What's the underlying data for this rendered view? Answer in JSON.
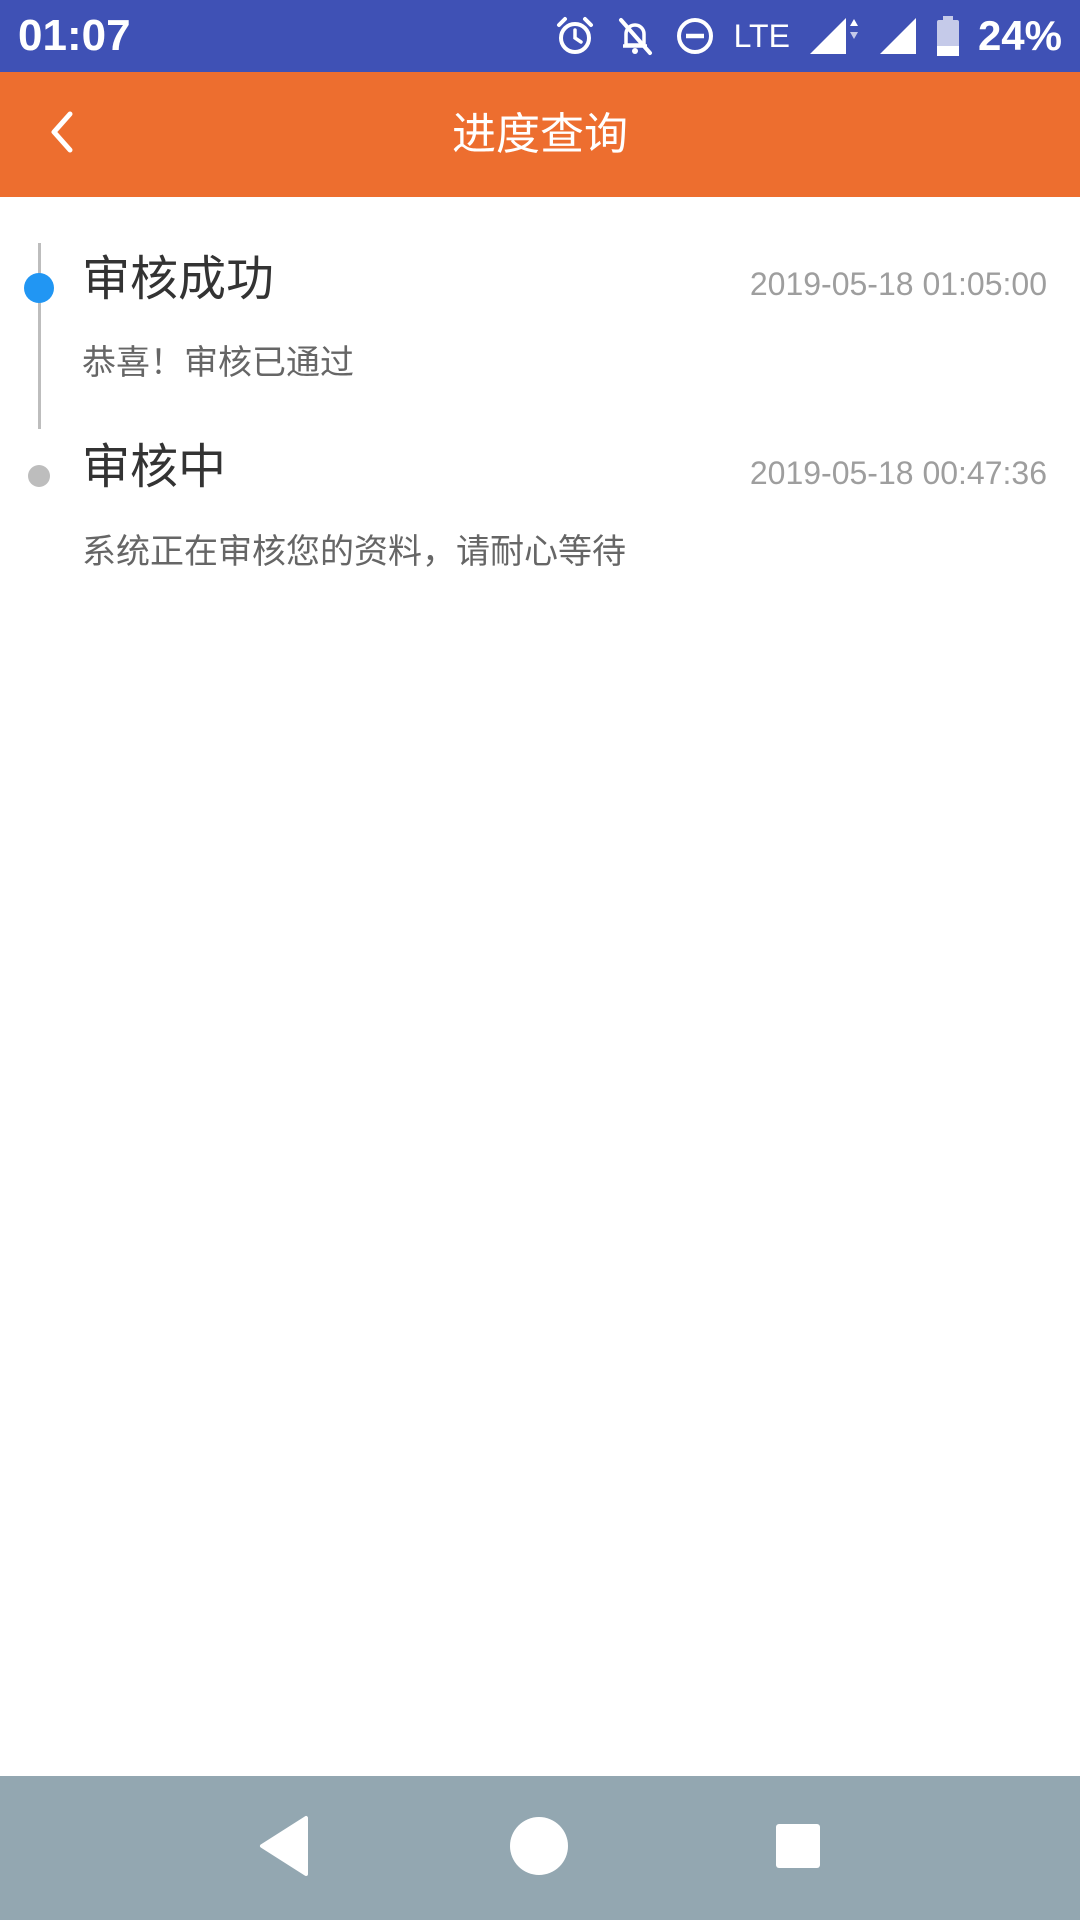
{
  "status_bar": {
    "time": "01:07",
    "network": "LTE",
    "battery": "24%",
    "icons": [
      "alarm-icon",
      "notifications-off-icon",
      "do-not-disturb-icon",
      "signal-icon",
      "signal-icon",
      "battery-icon"
    ]
  },
  "app_bar": {
    "title": "进度查询",
    "back_icon": "chevron-left-icon",
    "color": "#ed6e2f"
  },
  "timeline": {
    "steps": [
      {
        "title": "审核成功",
        "time": "2019-05-18 01:05:00",
        "description": "恭喜！审核已通过",
        "status": "active",
        "dot_color": "#2196f3"
      },
      {
        "title": "审核中",
        "time": "2019-05-18 00:47:36",
        "description": "系统正在审核您的资料，请耐心等待",
        "status": "done",
        "dot_color": "#bdbdbd"
      }
    ]
  },
  "nav_bar": {
    "buttons": [
      "back-triangle-icon",
      "home-circle-icon",
      "recents-square-icon"
    ]
  }
}
